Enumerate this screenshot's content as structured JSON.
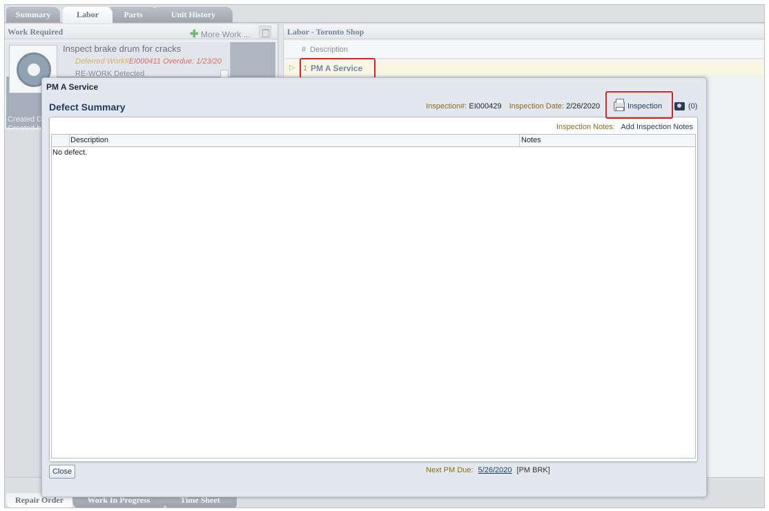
{
  "top_tabs": [
    "Summary",
    "Labor",
    "Parts",
    "Unit History"
  ],
  "work_required": {
    "header": "Work Required",
    "more_work": "More Work ...",
    "item_title": "Inspect brake drum for cracks",
    "deferred_label": "Deferred Work#",
    "deferred_id": "EI000411",
    "overdue": "Overdue: 1/23/20",
    "rework": "RE-WORK Detected",
    "created_date": "Created Da",
    "created_by": "Created by"
  },
  "labor": {
    "header": "Labor - Toronto Shop",
    "col_hash": "#",
    "col_desc": "Description",
    "row_num": "1",
    "row_name": "PM A Service"
  },
  "bottom_tabs": [
    "Repair Order",
    "Work In Progress",
    "Time Sheet"
  ],
  "dialog": {
    "title": "PM A Service",
    "subtitle": "Defect Summary",
    "inspection_num_label": "Inspection#:",
    "inspection_num": "EI000429",
    "inspection_date_label": "Inspection Date:",
    "inspection_date": "2/26/2020",
    "inspection_button": "Inspection",
    "camera_count": "(0)",
    "notes_label": "Inspection Notes:",
    "notes_link": "Add Inspection Notes",
    "grid_col_description": "Description",
    "grid_col_notes": "Notes",
    "grid_empty": "No defect.",
    "close_button": "Close",
    "next_pm_label": "Next PM Due:",
    "next_pm_date": "5/26/2020",
    "next_pm_code": "[PM BRK]"
  }
}
